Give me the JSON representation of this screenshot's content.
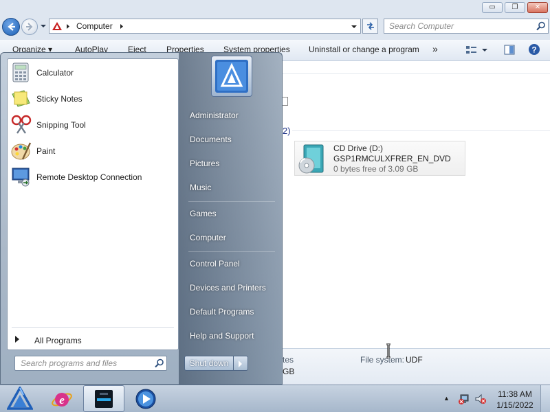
{
  "explorer": {
    "window_buttons": {
      "minimize": "▭",
      "restore": "❐",
      "close": "✕"
    },
    "breadcrumb": {
      "location": "Computer"
    },
    "search": {
      "placeholder": "Search Computer"
    },
    "toolbar": {
      "organize": "Organize",
      "autoplay": "AutoPlay",
      "eject": "Eject",
      "properties": "Properties",
      "system_properties": "System properties",
      "uninstall": "Uninstall or change a program",
      "more": "»"
    },
    "group_count_fragment": "2)",
    "drive": {
      "name": "CD Drive (D:)",
      "label": "GSP1RMCULXFRER_EN_DVD",
      "space": "0 bytes free of 3.09 GB"
    },
    "details": {
      "left_fragment_top": "tes",
      "left_fragment_bottom": "GB",
      "filesystem_label": "File system:",
      "filesystem_value": "UDF"
    }
  },
  "start_menu": {
    "programs": [
      {
        "label": "Calculator",
        "icon": "calculator-icon"
      },
      {
        "label": "Sticky Notes",
        "icon": "sticky-notes-icon"
      },
      {
        "label": "Snipping Tool",
        "icon": "snipping-tool-icon"
      },
      {
        "label": "Paint",
        "icon": "paint-icon"
      },
      {
        "label": "Remote Desktop Connection",
        "icon": "remote-desktop-icon"
      }
    ],
    "all_programs": "All Programs",
    "search_placeholder": "Search programs and files",
    "right": {
      "administrator": "Administrator",
      "documents": "Documents",
      "pictures": "Pictures",
      "music": "Music",
      "games": "Games",
      "computer": "Computer",
      "control_panel": "Control Panel",
      "devices_printers": "Devices and Printers",
      "default_programs": "Default Programs",
      "help_support": "Help and Support"
    },
    "shutdown": "Shut down"
  },
  "taskbar": {
    "clock_time": "11:38 AM",
    "clock_date": "1/15/2022",
    "tray_expand": "▲"
  },
  "colors": {
    "accent": "#1b5fb5",
    "start_menu_right": "#6e8298",
    "taskbar": "#b4c3d4"
  }
}
